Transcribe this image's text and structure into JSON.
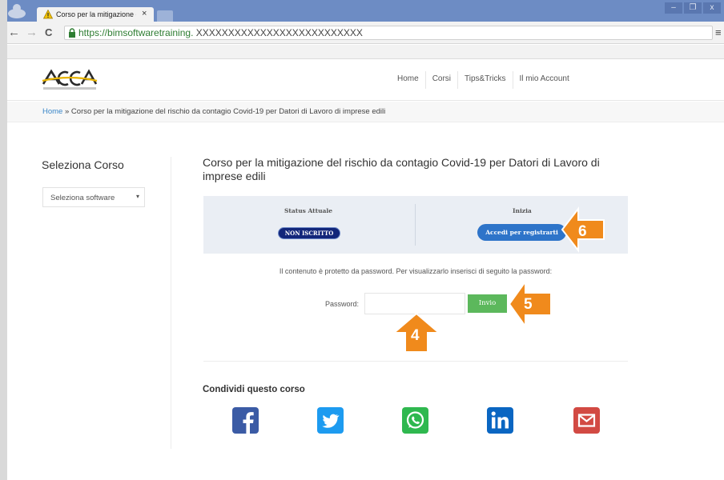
{
  "browser": {
    "tab_title": "Corso per la mitigazione c",
    "tab_close": "×",
    "url_host": "https://bimsoftwaretraining.",
    "url_masked": "XXXXXXXXXXXXXXXXXXXXXXXXXX",
    "win_minimize": "–",
    "win_restore": "❐",
    "win_close": "x",
    "back": "←",
    "forward": "→",
    "reload": "C",
    "menu": "≡"
  },
  "site": {
    "nav": [
      "Home",
      "Corsi",
      "Tips&Tricks",
      "Il mio Account"
    ],
    "breadcrumb_home": "Home",
    "breadcrumb_sep": "»",
    "breadcrumb_current": "Corso per la mitigazione del rischio da contagio Covid-19 per Datori di Lavoro di imprese edili"
  },
  "sidebar": {
    "title": "Seleziona Corso",
    "select_value": "Seleziona software",
    "caret": "▾"
  },
  "course": {
    "title": "Corso per la mitigazione del rischio da contagio Covid-19 per Datori di Lavoro di imprese edili",
    "status_label": "Status Attuale",
    "status_value": "NON ISCRITTO",
    "start_label": "Inizia",
    "register_button": "Accedi per registrarti",
    "password_note": "Il contenuto è protetto da password. Per visualizzarlo inserisci di seguito la password:",
    "password_label": "Password:",
    "submit_button": "Invio"
  },
  "share": {
    "title": "Condividi questo corso",
    "icons": [
      "facebook-icon",
      "twitter-icon",
      "whatsapp-icon",
      "linkedin-icon",
      "email-icon"
    ]
  },
  "annotations": {
    "step4": "4",
    "step5": "5",
    "step6": "6",
    "color": "#f08a1c"
  },
  "colors": {
    "titlebar": "#6d8cc4",
    "badge": "#12267a",
    "register": "#2e74c9",
    "submit": "#5cb85c",
    "link": "#3a86c8"
  }
}
